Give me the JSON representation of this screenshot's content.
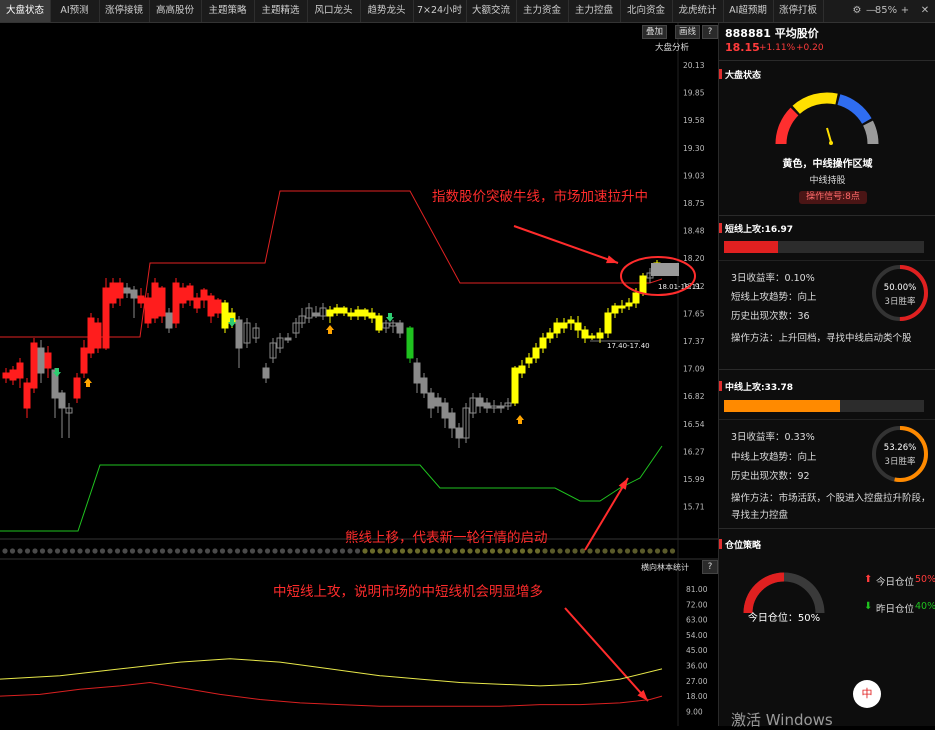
{
  "tabs": [
    {
      "label": "大盘状态",
      "active": true
    },
    {
      "label": "AI预测"
    },
    {
      "label": "涨停接镜"
    },
    {
      "label": "高高股份"
    },
    {
      "label": "主题策略"
    },
    {
      "label": "主题精选"
    },
    {
      "label": "风口龙头"
    },
    {
      "label": "趋势龙头"
    },
    {
      "label": "7×24小时"
    },
    {
      "label": "大额交流"
    },
    {
      "label": "主力资金"
    },
    {
      "label": "主力控盘"
    },
    {
      "label": "北向资金"
    },
    {
      "label": "龙虎统计"
    },
    {
      "label": "AI超预期"
    },
    {
      "label": "涨停打板"
    }
  ],
  "toolbar": {
    "gear": "⚙",
    "minus": "—",
    "zoom": "85%",
    "plus": "+",
    "close": "✕"
  },
  "chart": {
    "btn_overlay": "叠加",
    "btn_draw": "画线",
    "label_analysis": "大盘分析",
    "price_ticks": [
      "20.13",
      "19.85",
      "19.58",
      "19.30",
      "19.03",
      "18.75",
      "18.48",
      "18.20",
      "17.92",
      "17.65",
      "17.37",
      "17.09",
      "16.82",
      "16.54",
      "16.27",
      "15.99",
      "15.71"
    ],
    "lower_ticks": [
      "81.00",
      "72.00",
      "63.00",
      "54.00",
      "45.00",
      "36.00",
      "27.00",
      "18.00",
      "9.00"
    ],
    "label_hint1": "18.01-18.11",
    "label_hint2": "17.40-17.40",
    "lower_title": "横向林本统计",
    "help": "?"
  },
  "annotations": {
    "a1": "指数股价突破牛线，市场加速拉升中",
    "a2": "熊线上移，代表新一轮行情的启动",
    "a3": "中短线上攻，说明市场的中短线机会明显增多"
  },
  "right": {
    "code_name": "888881 平均股价",
    "price": "18.15",
    "change": "+1.11%",
    "change_abs": "+0.20",
    "market": {
      "title": "大盘状态",
      "status": "黄色，中线操作区域",
      "sub": "中线持股",
      "signal": "操作信号:8点"
    },
    "short": {
      "title": "短线上攻:16.97",
      "progress": 0.27,
      "r3": "3日收益率：0.10%",
      "trend": "短线上攻趋势：向上",
      "hist": "历史出现次数：36",
      "method": "操作方法：上升回档，寻找中线启动类个股",
      "rate": "50.00%",
      "rate_label": "3日胜率",
      "rate_value": 0.5
    },
    "mid": {
      "title": "中线上攻:33.78",
      "progress": 0.58,
      "r3": "3日收益率：0.33%",
      "trend": "中线上攻趋势：向上",
      "hist": "历史出现次数：92",
      "method1": "操作方法：市场活跃，个股进入控盘拉升阶段，",
      "method2": "寻找主力控盘",
      "rate": "53.26%",
      "rate_label": "3日胜率",
      "rate_value": 0.5326
    },
    "position": {
      "title": "仓位策略",
      "today": "今日仓位：50%",
      "today_value": 0.5,
      "legend_today": "今日仓位",
      "legend_today_val": "50%",
      "legend_yest": "昨日仓位",
      "legend_yest_val": "40%"
    },
    "watermark": "激活 Windows"
  },
  "colors": {
    "red": "#ff2020",
    "yellow": "#ffff00",
    "green": "#1fc21f",
    "gray": "#8a8a8a",
    "accent_orange": "#ff8a00"
  }
}
